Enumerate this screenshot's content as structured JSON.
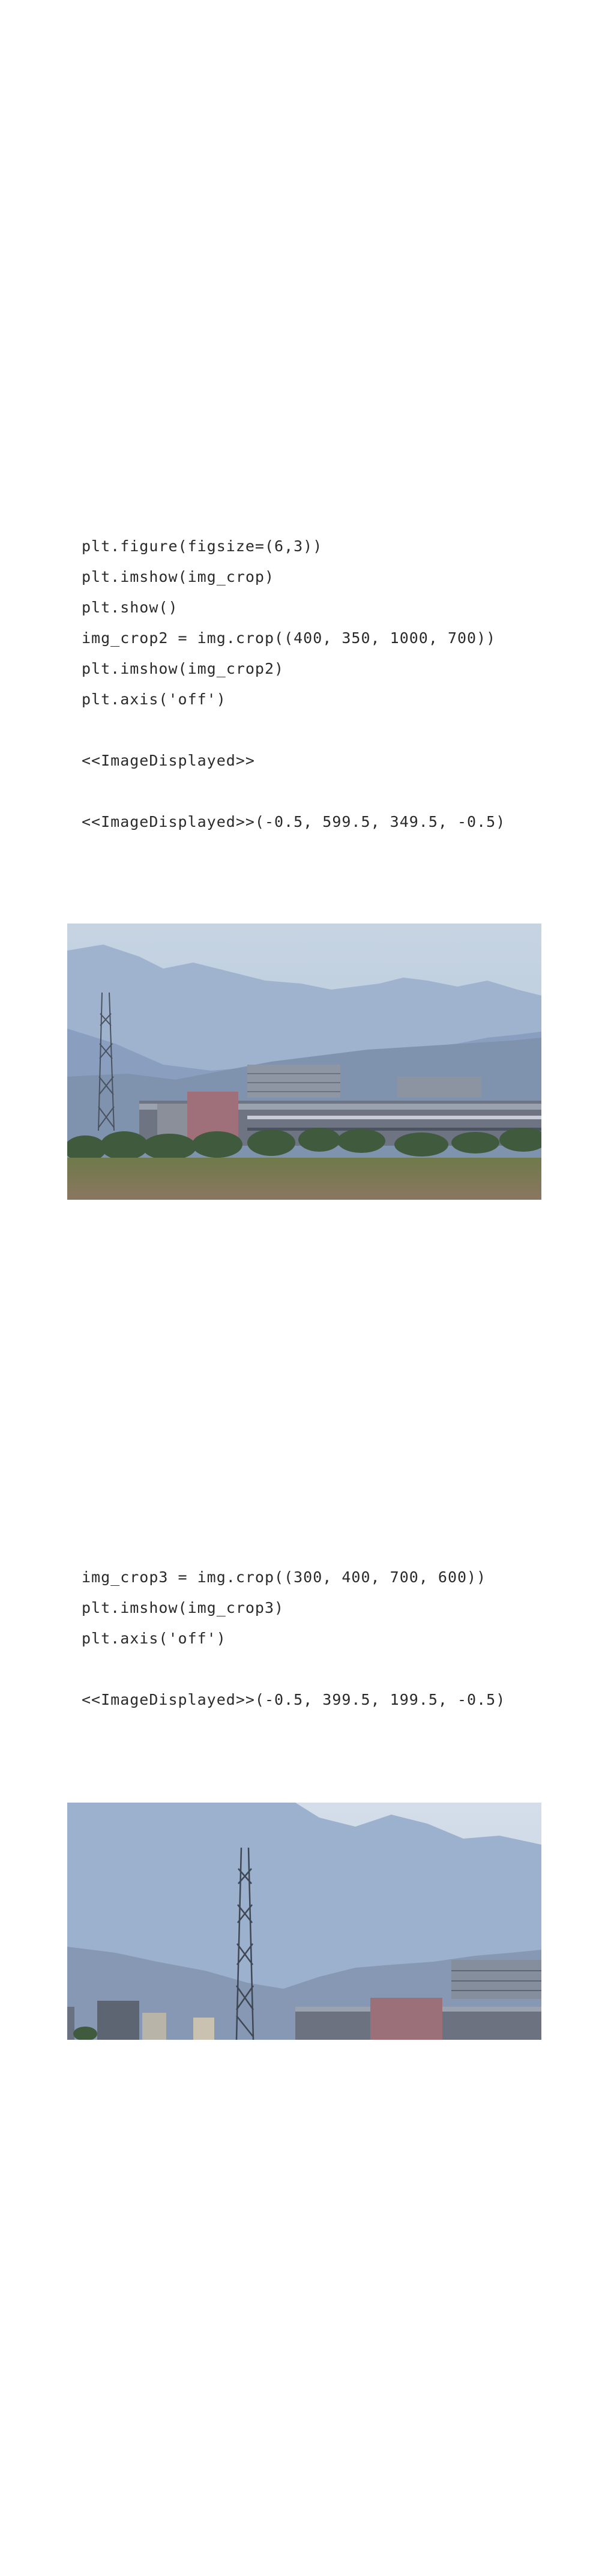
{
  "cell1": {
    "lines": [
      "plt.figure(figsize=(6,3))",
      "plt.imshow(img_crop)",
      "plt.show()",
      "img_crop2 = img.crop((400, 350, 1000, 700))",
      "plt.imshow(img_crop2)",
      "plt.axis('off')"
    ],
    "output_1": "<<ImageDisplayed>>",
    "output_2": "<<ImageDisplayed>>(-0.5, 599.5, 349.5, -0.5)"
  },
  "cell2": {
    "lines": [
      "img_crop3 = img.crop((300, 400, 700, 600))",
      "plt.imshow(img_crop3)",
      "plt.axis('off')"
    ],
    "output_1": "<<ImageDisplayed>>(-0.5, 399.5, 199.5, -0.5)"
  }
}
